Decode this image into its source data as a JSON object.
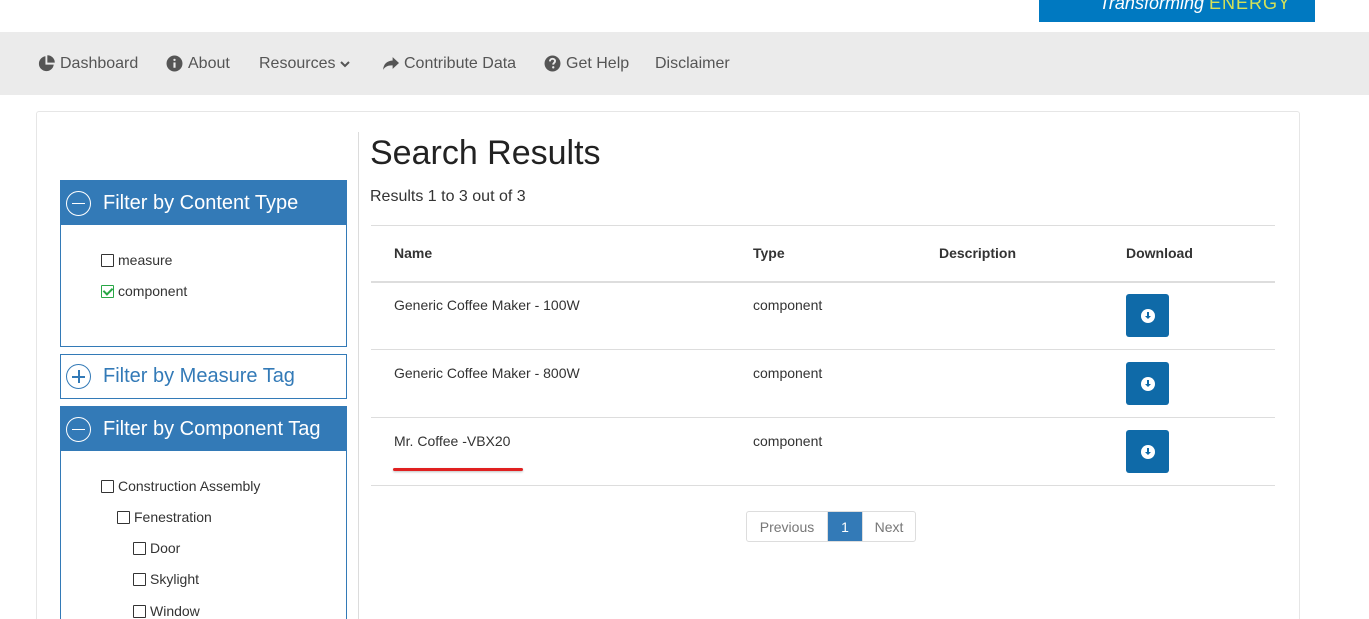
{
  "brand": {
    "text_italic": "Transforming ",
    "text_energy": "ENERGY",
    "color": "#0079c1"
  },
  "nav": {
    "items": [
      {
        "label": "Dashboard",
        "icon": "pie-chart-icon"
      },
      {
        "label": "About",
        "icon": "info-circle-icon"
      },
      {
        "label": "Resources",
        "icon": "chevron-down-icon"
      },
      {
        "label": "Contribute Data",
        "icon": "share-arrow-icon"
      },
      {
        "label": "Get Help",
        "icon": "question-circle-icon"
      },
      {
        "label": "Disclaimer",
        "icon": ""
      }
    ]
  },
  "filters": {
    "content_type": {
      "title": "Filter by Content Type",
      "options": [
        {
          "label": "measure",
          "checked": false
        },
        {
          "label": "component",
          "checked": true
        }
      ]
    },
    "measure_tag": {
      "title": "Filter by Measure Tag"
    },
    "component_tag": {
      "title": "Filter by Component Tag",
      "options": [
        {
          "label": "Construction Assembly",
          "checked": false,
          "level": 0
        },
        {
          "label": "Fenestration",
          "checked": false,
          "level": 1
        },
        {
          "label": "Door",
          "checked": false,
          "level": 2
        },
        {
          "label": "Skylight",
          "checked": false,
          "level": 2
        },
        {
          "label": "Window",
          "checked": false,
          "level": 2
        }
      ]
    }
  },
  "results": {
    "title": "Search Results",
    "count_text": "Results 1 to 3 out of 3",
    "columns": [
      "Name",
      "Type",
      "Description",
      "Download"
    ],
    "rows": [
      {
        "name": "Generic Coffee Maker - 100W",
        "type": "component",
        "description": ""
      },
      {
        "name": "Generic Coffee Maker - 800W",
        "type": "component",
        "description": ""
      },
      {
        "name": "Mr. Coffee -VBX20",
        "type": "component",
        "description": ""
      }
    ]
  },
  "pagination": {
    "prev": "Previous",
    "current": "1",
    "next": "Next"
  },
  "colors": {
    "primary": "#337ab7",
    "download": "#0f6aa8",
    "nav_bg": "#ebebeb",
    "annotation": "#e02020"
  }
}
